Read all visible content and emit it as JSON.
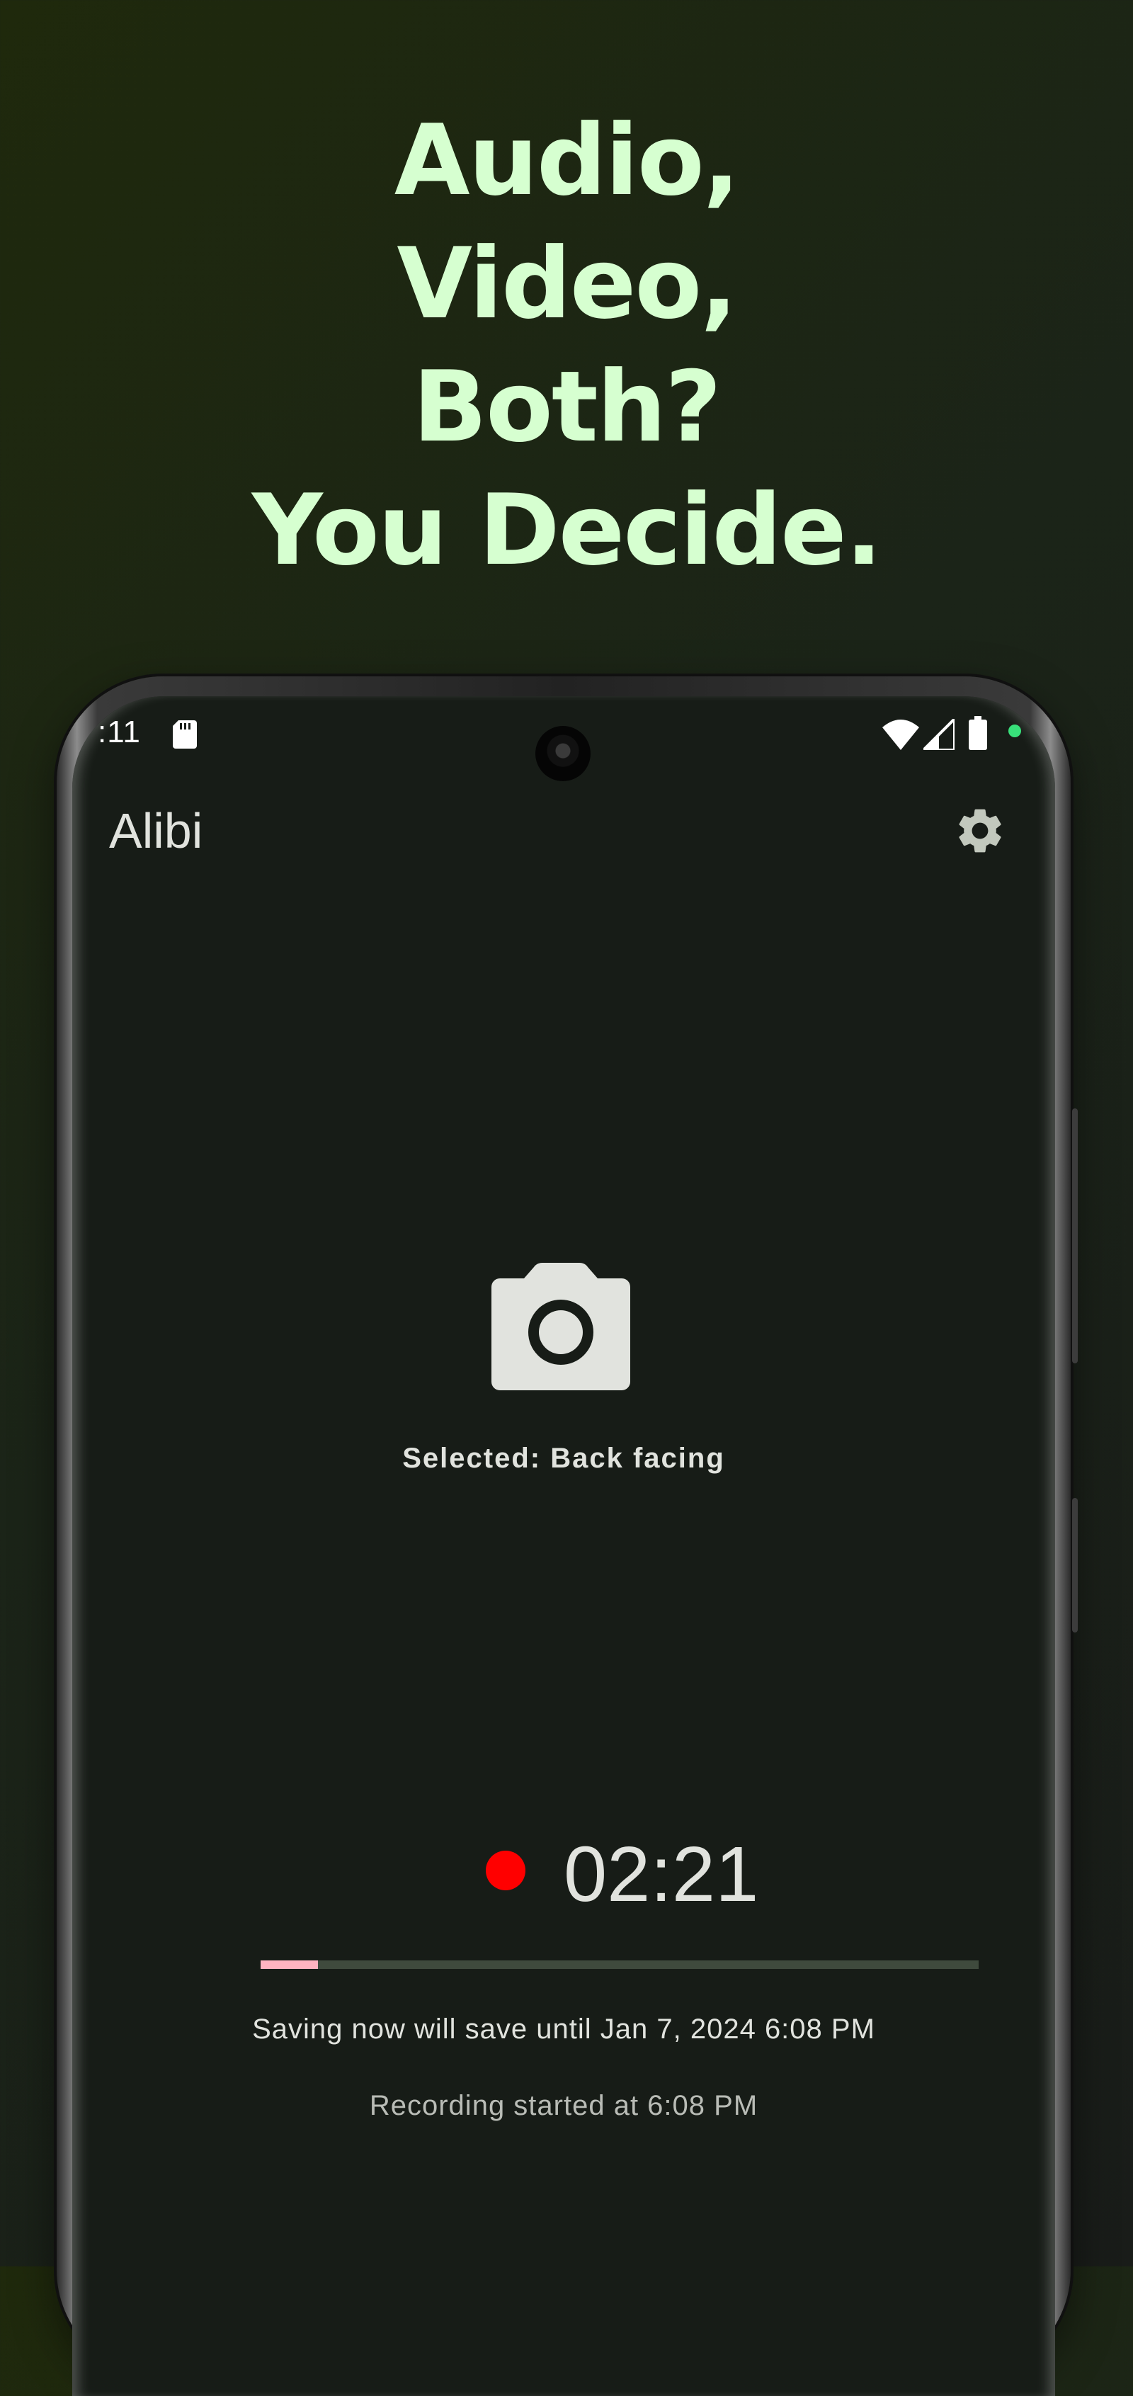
{
  "headline": {
    "lines": [
      "Audio,",
      "Video,",
      "Both?",
      "You Decide."
    ]
  },
  "status_bar": {
    "time": ":11",
    "icons": [
      "sd-card-icon",
      "wifi-icon",
      "cellular-signal-icon",
      "battery-icon"
    ]
  },
  "app_bar": {
    "title": "Alibi",
    "settings_icon": "gear-icon"
  },
  "camera": {
    "icon": "camera-icon",
    "selected_label": "Selected: Back facing"
  },
  "recording": {
    "timer": "02:21",
    "progress_fraction": 0.08,
    "saving_text": "Saving now will save until Jan 7, 2024 6:08 PM",
    "started_text": "Recording started at 6:08 PM"
  },
  "colors": {
    "headline": "#d6ffd0",
    "background_top": "#1f290c",
    "screen_background": "#171c17",
    "recording_dot": "#ff0000",
    "progress_fill": "#ffb3c0",
    "progress_track": "#3f4a3d",
    "text_primary": "#e1e3de"
  }
}
